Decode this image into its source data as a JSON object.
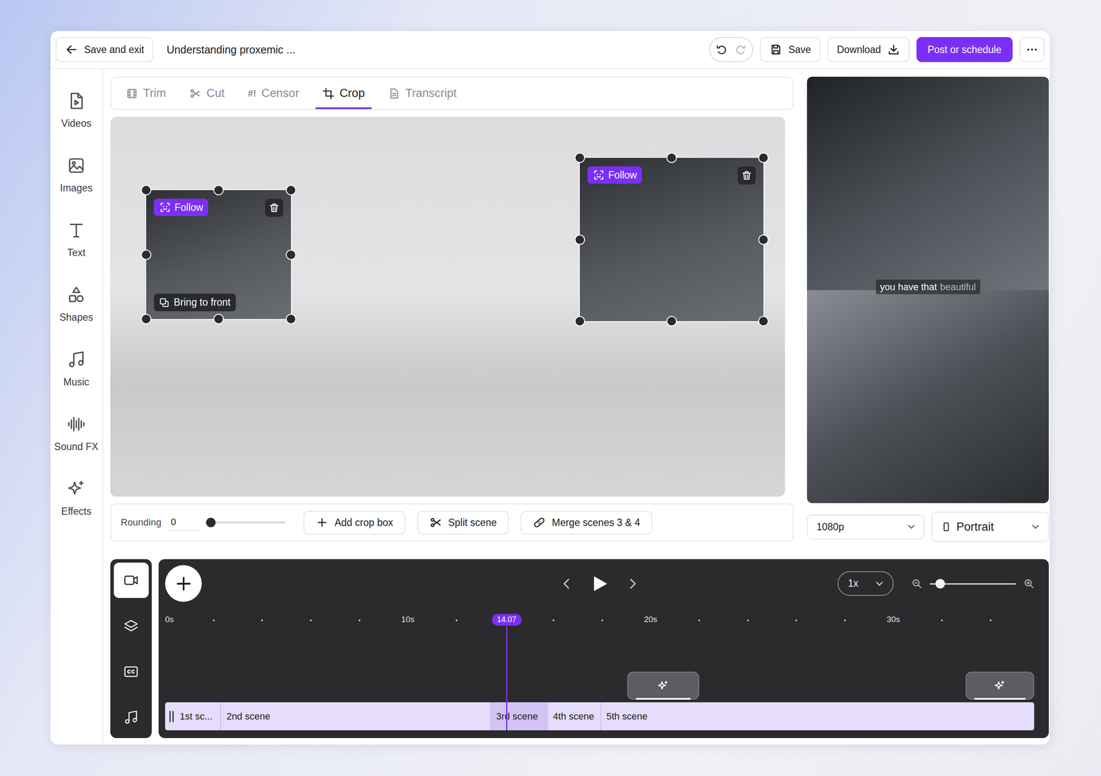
{
  "window": {
    "title": "Understanding proxemic ..."
  },
  "topbar": {
    "back_button": "Save and exit",
    "undo": {
      "disabled": false
    },
    "redo": {
      "disabled": true
    },
    "save_button": "Save",
    "download_button": "Download",
    "post_button": "Post or schedule"
  },
  "sidebar": {
    "items": [
      {
        "label": "Videos"
      },
      {
        "label": "Images"
      },
      {
        "label": "Text"
      },
      {
        "label": "Shapes"
      },
      {
        "label": "Music"
      },
      {
        "label": "Sound FX"
      },
      {
        "label": "Effects"
      }
    ]
  },
  "tabs": [
    {
      "label": "Trim",
      "selected": false
    },
    {
      "label": "Cut",
      "selected": false
    },
    {
      "label": "Censor",
      "icon": "#!",
      "selected": false
    },
    {
      "label": "Crop",
      "selected": true
    },
    {
      "label": "Transcript",
      "selected": false
    }
  ],
  "crop_boxes": [
    {
      "follow_label": "Follow",
      "active": true,
      "front_label": "Bring to front"
    },
    {
      "follow_label": "Follow",
      "active": true
    }
  ],
  "controls": {
    "rounding_label": "Rounding",
    "rounding_value": "0",
    "rounding_level": 0,
    "buttons": [
      "Add crop box",
      "Split scene",
      "Merge scenes 3 & 4"
    ]
  },
  "preview": {
    "caption": [
      {
        "text": "you have that",
        "spoken": true
      },
      {
        "text": "beautiful",
        "spoken": false
      }
    ]
  },
  "resolution": {
    "value": "1080p"
  },
  "orientation": {
    "value": "Portrait"
  },
  "timeline": {
    "tools": [
      {
        "selected": true
      },
      {
        "selected": false
      },
      {
        "selected": false
      },
      {
        "selected": false
      }
    ],
    "speed": "1x",
    "zoom_level": 0.12,
    "ruler": [
      {
        "text": "0s",
        "time": 0
      },
      {
        "text": "10s",
        "time": 10
      },
      {
        "text": "20s",
        "time": 20
      },
      {
        "text": "30s",
        "time": 30
      }
    ],
    "playhead": {
      "label": "14.07",
      "time": 14.07
    },
    "scenes": [
      {
        "label": "1st sc...",
        "start": 0,
        "end": 2.28,
        "selected": false
      },
      {
        "label": "2nd scene",
        "start": 2.28,
        "end": 13.39,
        "selected": false
      },
      {
        "label": "3rd scene",
        "start": 13.39,
        "end": 15.73,
        "selected": true
      },
      {
        "label": "4th scene",
        "start": 15.73,
        "end": 17.93,
        "selected": false
      },
      {
        "label": "5th scene",
        "start": 17.93,
        "end": 35.8,
        "selected": false
      }
    ],
    "effects": [
      {
        "start": 19.03,
        "end": 22.0
      },
      {
        "start": 32.97,
        "end": 35.8
      }
    ]
  }
}
